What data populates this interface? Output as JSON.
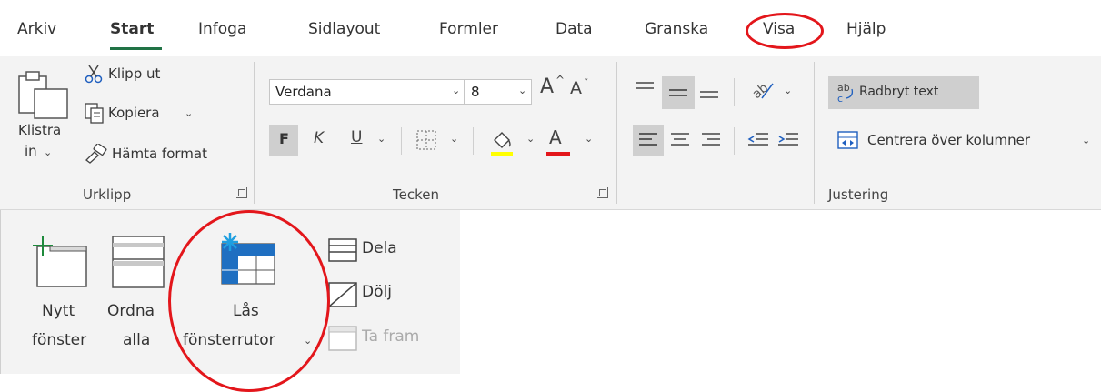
{
  "tabs": [
    {
      "label": "Arkiv"
    },
    {
      "label": "Start"
    },
    {
      "label": "Infoga"
    },
    {
      "label": "Sidlayout"
    },
    {
      "label": "Formler"
    },
    {
      "label": "Data"
    },
    {
      "label": "Granska"
    },
    {
      "label": "Visa"
    },
    {
      "label": "Hjälp"
    }
  ],
  "active_tab": "Start",
  "accent_color": "#217346",
  "annotation_color": "#e3161b",
  "clipboard": {
    "paste_label_1": "Klistra",
    "paste_label_2": "in",
    "cut_label": "Klipp ut",
    "copy_label": "Kopiera",
    "format_painter_label": "Hämta format",
    "group_label": "Urklipp"
  },
  "font": {
    "font_name": "Verdana",
    "font_size": "8",
    "grow_font": "A",
    "shrink_font": "A",
    "bold": "F",
    "italic": "K",
    "underline": "U",
    "font_color_glyph": "A",
    "fill_color": "#ffff00",
    "text_color": "#e3161b",
    "group_label": "Tecken"
  },
  "alignment": {
    "wrap_text_label": "Radbryt text",
    "merge_center_label": "Centrera över kolumner",
    "group_label": "Justering"
  },
  "view_panel": {
    "new_window_1": "Nytt",
    "new_window_2": "fönster",
    "arrange_1": "Ordna",
    "arrange_2": "alla",
    "freeze_1": "Lås",
    "freeze_2": "fönsterrutor",
    "split_label": "Dela",
    "hide_label": "Dölj",
    "unhide_label": "Ta fram"
  }
}
